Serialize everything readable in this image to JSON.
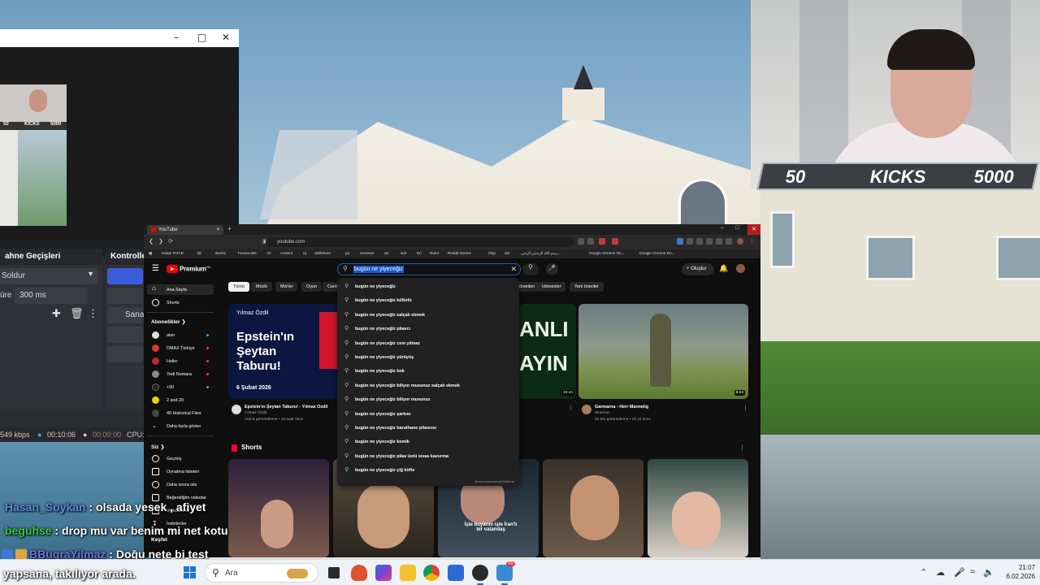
{
  "webcam_overlay": {
    "left": "50",
    "center": "KICKS",
    "right": "5000"
  },
  "obs": {
    "transitions_header": "ahne Geçişleri",
    "controls_header": "Kontroller",
    "transition_value": "Soldur",
    "duration_label": "üre",
    "duration_value": "300 ms",
    "virtual_button": "Sanal",
    "thumb_left": "50",
    "thumb_center": "KICKS",
    "thumb_right": "5000",
    "status_bitrate": "549 kbps",
    "status_time": "00:10:06",
    "status_rec": "00:00:00",
    "status_cpu": "CPU:"
  },
  "browser": {
    "tab_title": "YouTube",
    "url": "youtube.com",
    "bookmarks": [
      "Haluk TATAR",
      "bk",
      "stocks",
      "FaveeLabs",
      "IG",
      "content",
      "rq",
      "Skillshare",
      "pa",
      "reveews",
      "art",
      "seli",
      "Eri",
      "Rumi",
      "Reddit Stories",
      "nfop",
      "wtt",
      "رسم الله الرحمن الرحي...",
      "Google Chrome Do...",
      "Google Chrome Do..."
    ]
  },
  "youtube": {
    "brand": "Premium",
    "brand_sup": "HU",
    "search_query": "bugün ne yiyeceğiz",
    "create_label": "Oluştur",
    "chips": [
      "Tümü",
      "Müzik",
      "Mix'ler",
      "Oyun",
      "Canlı",
      "önerilen",
      "İzlenenler",
      "Yeni öneriler"
    ],
    "sidebar": {
      "home": "Ana Sayfa",
      "shorts": "Shorts",
      "subscriptions_header": "Abonelikler",
      "subscriptions": [
        "alan",
        "DMAX Türkiye",
        "Halkv",
        "Yedi Numara",
        "+90",
        "2 and 20",
        "40 Historical Files"
      ],
      "show_more": "Daha fazla göster",
      "you_header": "Siz",
      "you_items": [
        "Geçmiş",
        "Oynatma listeleri",
        "Daha sonra izle",
        "Beğendiğim videolar",
        "Videolarınız",
        "İndirilenler"
      ],
      "explore_header": "Keşfet"
    },
    "videos": [
      {
        "thumb_author": "Yılmaz Özdil",
        "thumb_title_1": "Epstein'ın",
        "thumb_title_2": "Şeytan",
        "thumb_title_3": "Taburu!",
        "thumb_date": "6 Şubat 2026",
        "title": "Epstein'ın Şeytan Taburu! - Yılmaz Özdil",
        "channel": "Yılmaz Özdil",
        "meta": "215 B görüntüleme • 12 saat önce"
      },
      {
        "thumb_text_1": "ANLI",
        "thumb_text_2": "AYIN",
        "duration": "19:44"
      },
      {
        "title": "Garmarna - Herr Mannelig",
        "channel": "Mnemon",
        "meta": "32 Mn görüntüleme • 10 yıl önce",
        "duration": "6:24"
      }
    ],
    "shorts_header": "Shorts",
    "shorts_caption": "İşte buyarım işte İran'lı bir vatandaş",
    "suggestions": [
      "bugün ne yiyeceğiz",
      "bugün ne yiyeceğiz küfürlü",
      "bugün ne yiyeceğiz salçalı ekmek",
      "bugün ne yiyeceğiz pilavcı",
      "bugün ne yiyeceğiz cem yılmaz",
      "bugün ne yiyeceğiz yürüyüş",
      "bugün ne yiyeceğiz bok",
      "bugün ne yiyeceğiz biliyor musunuz salçalı ekmek",
      "bugün ne yiyeceğiz biliyor musunuz",
      "bugün ne yiyeceğiz şarkısı",
      "bugün ne yiyeceğiz baruthane pilavcısı",
      "bugün ne yiyeceğiz komik",
      "bugün ne yiyeceğiz pilav üstü sivas kavurma",
      "bugün ne yiyeceğiz çiğ köfte"
    ],
    "suggestions_footer": "Arama tahminlerini bildirme"
  },
  "chat": [
    {
      "user": "Hasan_Soykan",
      "text": ": olsada yesek , afiyet"
    },
    {
      "user": "beguhse",
      "text": ": drop mu var benim mi net kotu"
    },
    {
      "user": "BBugraYilmaz",
      "text": ": Doğu nete bi test"
    }
  ],
  "chat_bottom": "yapsana, takılıyor arada.",
  "taskbar": {
    "search_placeholder": "Ara",
    "time": "21:07",
    "date": "6.02.2026",
    "badge_count": "99"
  },
  "colors": {
    "youtube_red": "#ff0000",
    "accent_blue": "#1a56c6",
    "chat_green": "#37c93a"
  }
}
